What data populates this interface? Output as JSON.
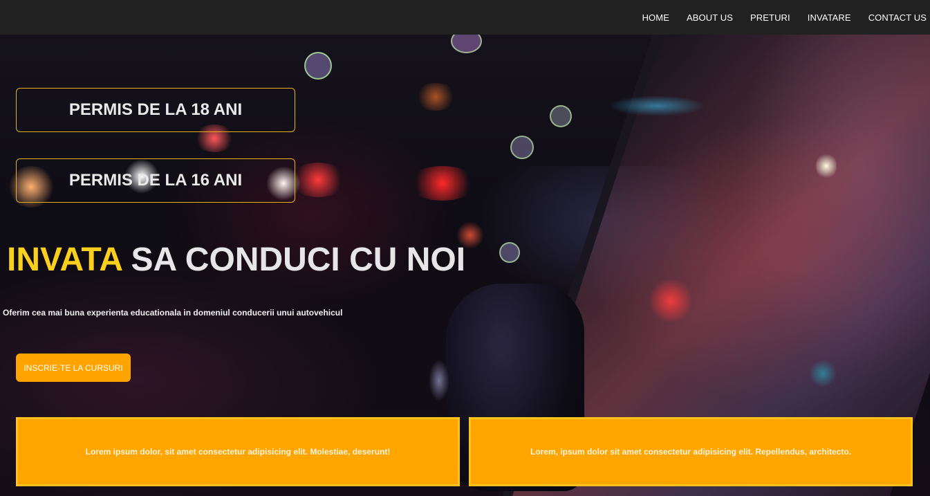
{
  "nav": {
    "items": [
      {
        "label": "HOME"
      },
      {
        "label": "ABOUT US"
      },
      {
        "label": "PRETURI"
      },
      {
        "label": "INVATARE"
      },
      {
        "label": "CONTACT US"
      }
    ]
  },
  "hero": {
    "permit_18": "PERMIS DE LA 18 ANI",
    "permit_16": "PERMIS DE LA 16 ANI",
    "headline_accent": "INVATA",
    "headline_rest": " SA CONDUCI CU NOI",
    "subtitle": "Oferim cea mai buna experienta educationala in domeniul conducerii unui autovehicul",
    "cta_label": "INSCRIE-TE LA CURSURI"
  },
  "cards": [
    {
      "text": "Lorem ipsum dolor, sit amet consectetur adipisicing elit. Molestiae, deserunt!"
    },
    {
      "text": "Lorem, ipsum dolor sit amet consectetur adipisicing elit. Repellendus, architecto."
    }
  ],
  "colors": {
    "accent_yellow": "#fbd01d",
    "button_orange": "#ffa300",
    "card_orange": "#ffa500",
    "nav_bg": "#212121"
  }
}
